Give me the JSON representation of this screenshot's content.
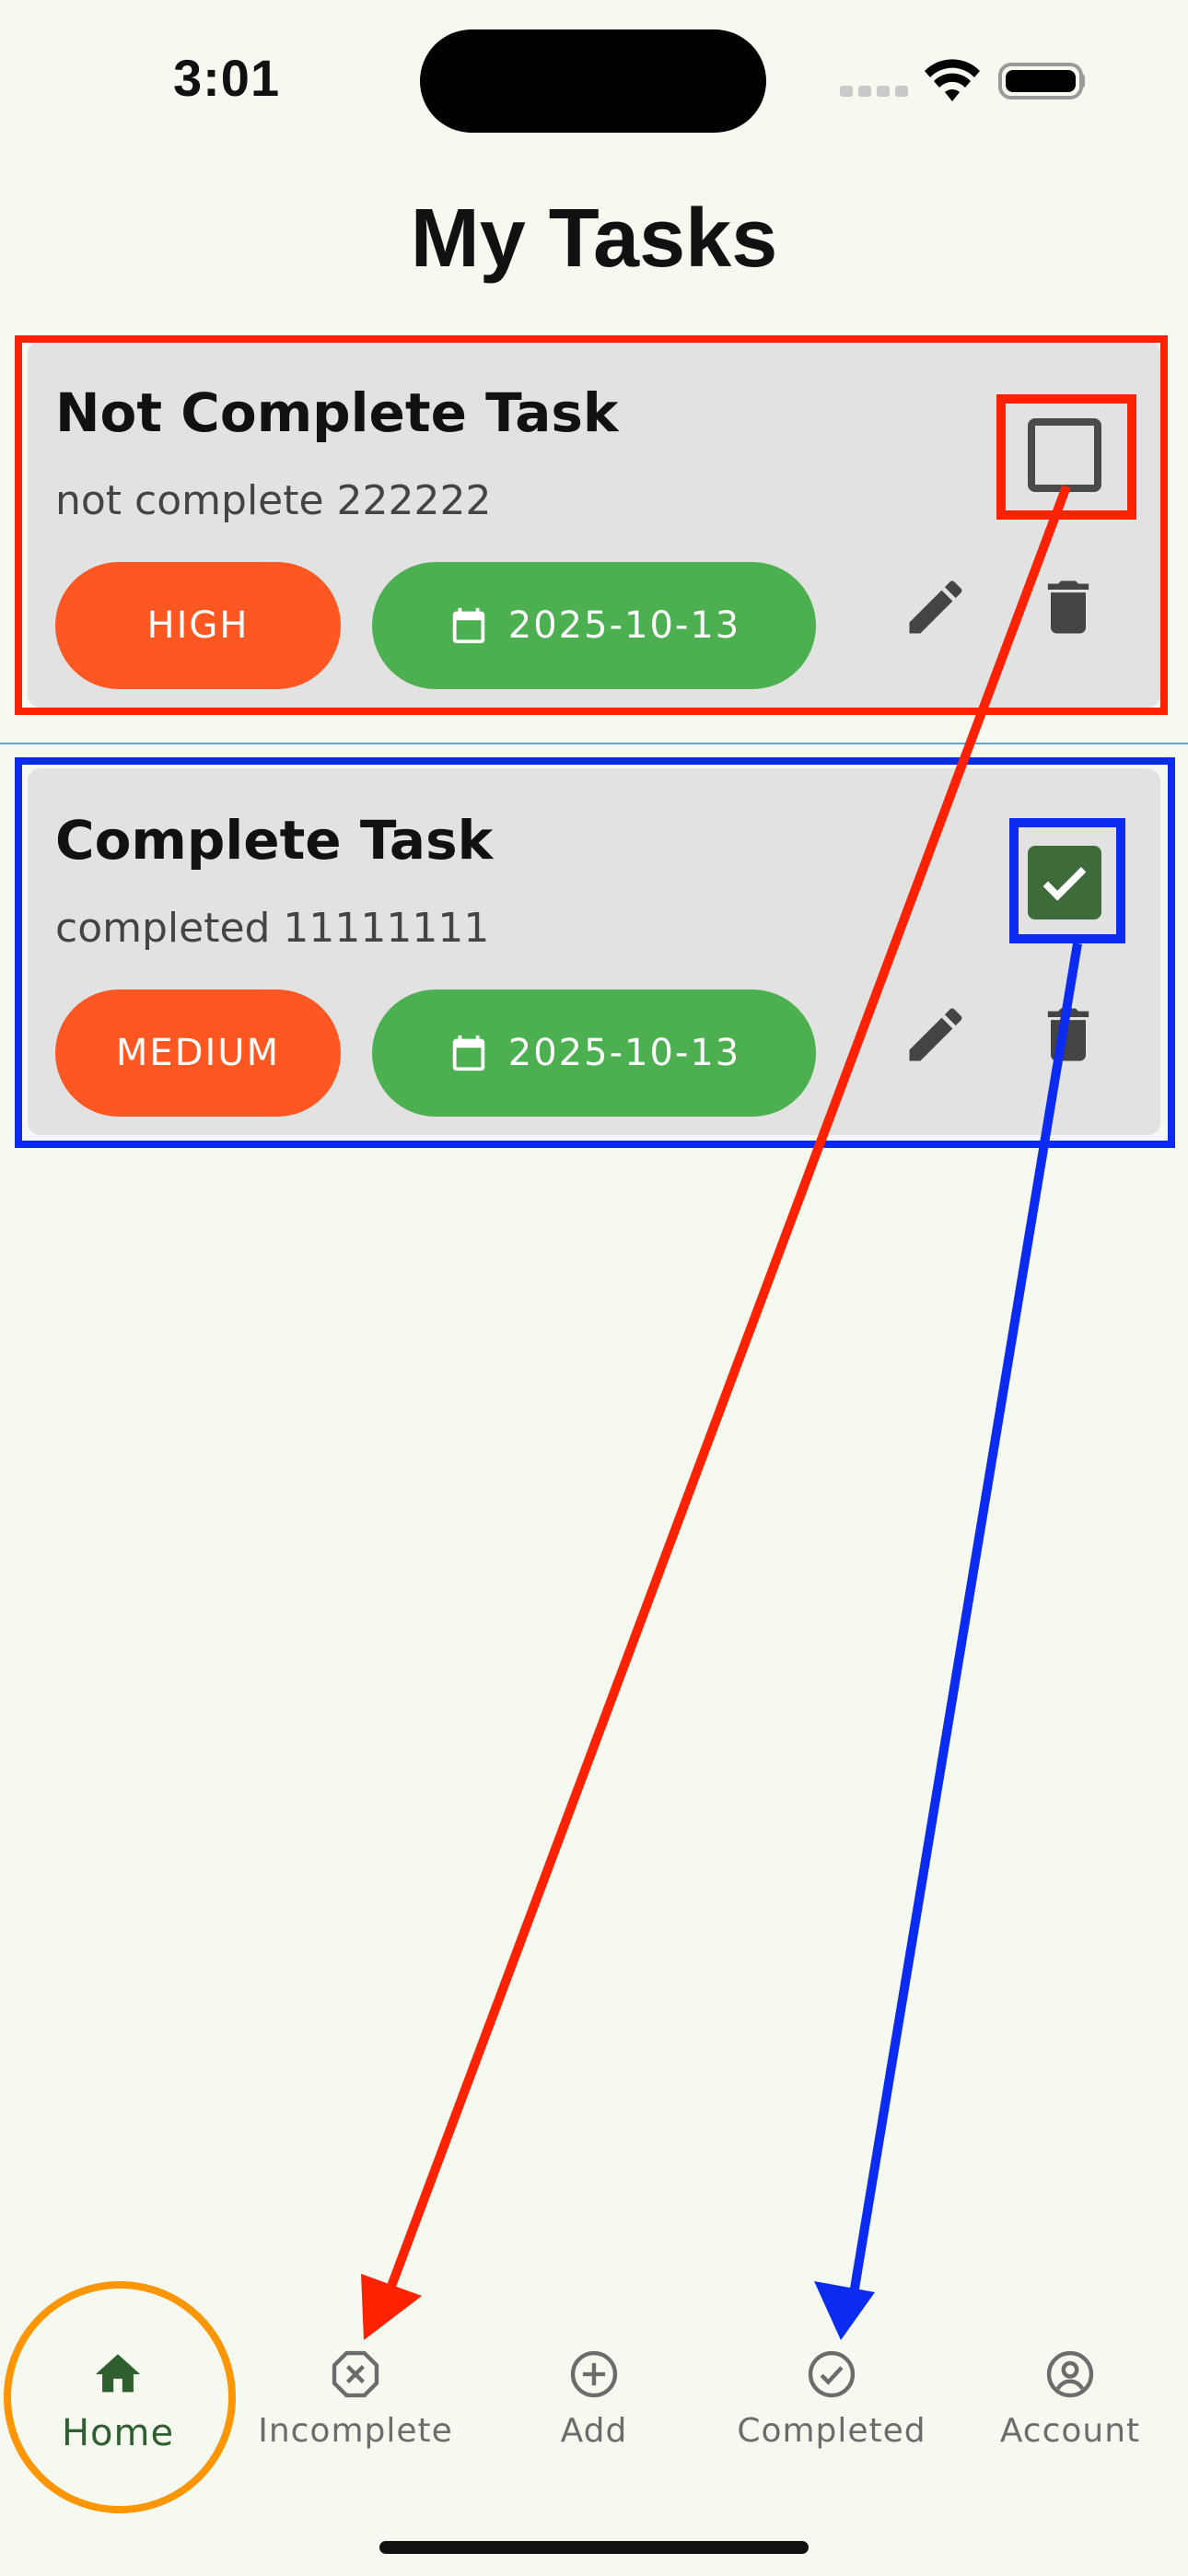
{
  "status_bar": {
    "time": "3:01"
  },
  "header": {
    "title": "My Tasks"
  },
  "tasks": [
    {
      "title": "Not Complete Task",
      "description": "not complete 222222",
      "priority": "HIGH",
      "due_date": "2025-10-13",
      "completed": false
    },
    {
      "title": "Complete Task",
      "description": "completed 11111111",
      "priority": "MEDIUM",
      "due_date": "2025-10-13",
      "completed": true
    }
  ],
  "nav": {
    "items": [
      {
        "label": "Home",
        "icon": "home-icon",
        "active": true
      },
      {
        "label": "Incomplete",
        "icon": "x-circle-icon",
        "active": false
      },
      {
        "label": "Add",
        "icon": "plus-circle-icon",
        "active": false
      },
      {
        "label": "Completed",
        "icon": "check-circle-icon",
        "active": false
      },
      {
        "label": "Account",
        "icon": "account-circle-icon",
        "active": false
      }
    ]
  },
  "colors": {
    "background": "#f5f9f0",
    "card": "#e2e2e2",
    "priority": "#ff5722",
    "date": "#4caf50",
    "checkbox_checked": "#3d6b3a",
    "nav_active": "#2f5e2f",
    "annotation_red": "#ff2200",
    "annotation_blue": "#0b2cf0",
    "annotation_orange": "#ff9500"
  }
}
